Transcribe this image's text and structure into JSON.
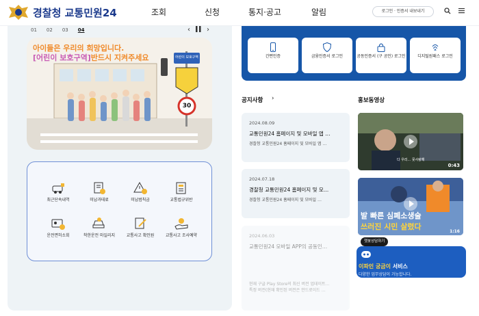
{
  "header": {
    "logo_text": "경찰청 교통민원24",
    "nav": [
      "조회",
      "신청",
      "통지·공고",
      "알림"
    ],
    "login_button": "로그인 · 인증서 내보내기",
    "search_icon": "search-icon",
    "menu_icon": "menu-icon"
  },
  "slider": {
    "pages": [
      "01",
      "02",
      "03",
      "04"
    ],
    "current": "04"
  },
  "banner": {
    "line1": "아이들은 우리의 희망입니다.",
    "line2_highlight": "[어린이 보호구역]",
    "line2_rest": "반드시 지켜주세요",
    "sign_text": "어린이 보호구역",
    "speed_limit": "30"
  },
  "services": [
    {
      "label": "최근단속내역"
    },
    {
      "label": "미납과태료"
    },
    {
      "label": "미납범칙금"
    },
    {
      "label": "교통법규위반"
    },
    {
      "label": "운전면허소회"
    },
    {
      "label": "착한운전 마일리지"
    },
    {
      "label": "교통사고 확인원"
    },
    {
      "label": "교통사고 조사예약"
    }
  ],
  "auth": [
    {
      "label": "간편인증"
    },
    {
      "label": "금융인증서 로그인"
    },
    {
      "label": "공동인증서 (구 공인) 로그인"
    },
    {
      "label": "디지털원패스 로그인"
    }
  ],
  "notices": {
    "title": "공지사항",
    "items": [
      {
        "date": "2024.08.09",
        "title": "교통민원24 홈페이지 및 모바일 앱 …",
        "summary": "경찰청 교통민원24 홈페이지 및 모바일 앱 …"
      },
      {
        "date": "2024.07.18",
        "title": "경찰청 교통민원24 홈페이지 및 모…",
        "summary": "경찰청 교통민원24 홈페이지 및 모바일 …"
      },
      {
        "date": "2024.06.03",
        "title": "교통민원24 모바일 APP의 공동인…",
        "summary": "현재 구글 Play Store의 최신 버전 업데이트…",
        "summary2": "특정 버전(현재 확인된 버전은 안드로이드 …"
      }
    ]
  },
  "videos": {
    "title": "홍보동영상",
    "items": [
      {
        "duration": "0:43",
        "caption": "다 우리… 못사랑해"
      },
      {
        "duration": "1:16",
        "caption1": "발 빠른 심폐소생술",
        "caption2": "쓰러진 시민 살렸다"
      }
    ]
  },
  "chatbot": {
    "tooltip": "챗봇상담하기",
    "title_highlight": "이파인 궁금이",
    "title_rest": " 서비스",
    "subtitle": "다양한 업무상담이 가능합니다."
  }
}
